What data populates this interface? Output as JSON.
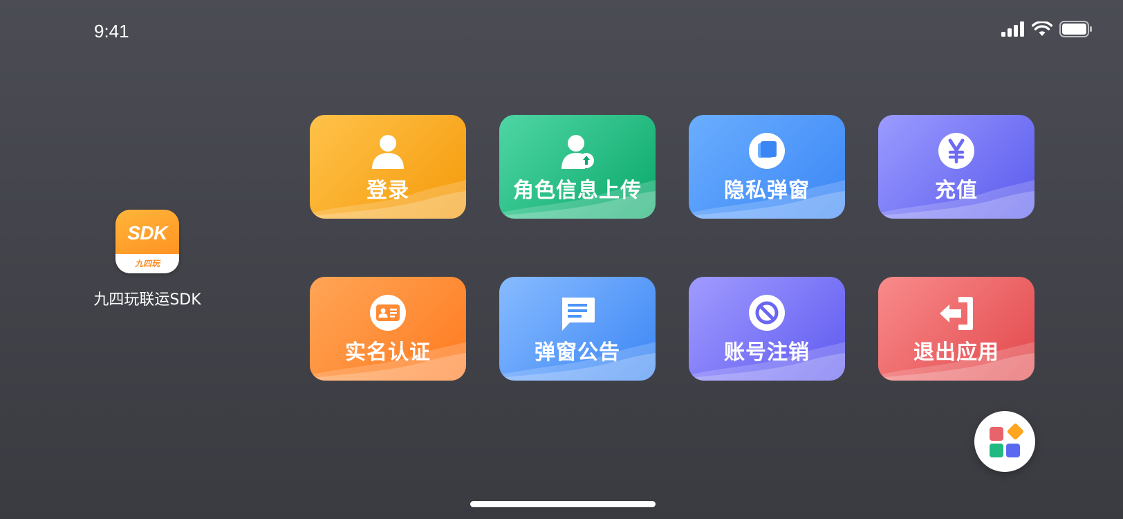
{
  "status_bar": {
    "time": "9:41"
  },
  "app": {
    "icon_text": "SDK",
    "icon_subtext": "九四玩",
    "name": "九四玩联运SDK"
  },
  "tiles": [
    {
      "label": "登录",
      "icon": "user-icon",
      "colors": [
        "#ffc24a",
        "#f59a0a"
      ]
    },
    {
      "label": "角色信息上传",
      "icon": "user-upload-icon",
      "colors": [
        "#4fd6a4",
        "#0aa86a"
      ]
    },
    {
      "label": "隐私弹窗",
      "icon": "window-icon",
      "colors": [
        "#6aaeff",
        "#3b86f5"
      ]
    },
    {
      "label": "充值",
      "icon": "yen-icon",
      "colors": [
        "#9b9bff",
        "#5a5aee"
      ]
    },
    {
      "label": "实名认证",
      "icon": "id-card-icon",
      "colors": [
        "#ffa556",
        "#ff7a1f"
      ]
    },
    {
      "label": "弹窗公告",
      "icon": "message-icon",
      "colors": [
        "#88bbff",
        "#3b86f5"
      ]
    },
    {
      "label": "账号注销",
      "icon": "block-icon",
      "colors": [
        "#a09bff",
        "#5f5af0"
      ]
    },
    {
      "label": "退出应用",
      "icon": "exit-icon",
      "colors": [
        "#f98b8b",
        "#e2484c"
      ]
    }
  ],
  "float_button": {
    "icon": "apps-grid-icon",
    "colors": [
      "#e8646a",
      "#ffa51f",
      "#1fb981",
      "#5a6af0"
    ]
  }
}
